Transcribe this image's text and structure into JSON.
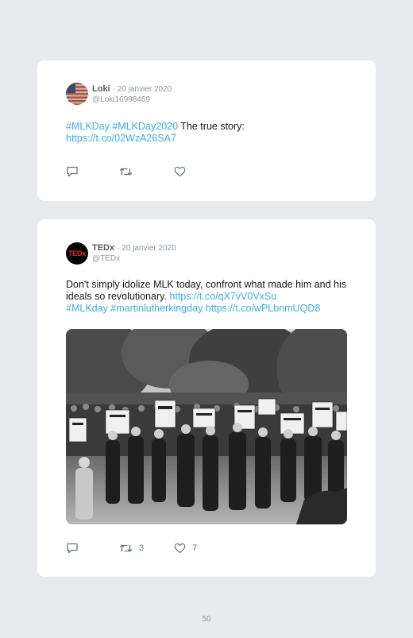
{
  "tweets": [
    {
      "name": "Loki",
      "date": "· 20 janvier 2020",
      "handle": "@Loki16998469",
      "text_parts": [
        {
          "t": "#MLKDay #MLKDay2020",
          "link": true
        },
        {
          "t": " The true story:",
          "link": false
        },
        {
          "t": "https://t.co/02WzA26SA7",
          "link": true
        }
      ],
      "retweets": "",
      "likes": ""
    },
    {
      "name": "TEDx",
      "date": "· 20 janvier 2020",
      "handle": "@TEDx",
      "avatar_text": "TEDx",
      "text_parts": [
        {
          "t": "Don't simply idolize MLK today, confront what made him and his ideals so revolutionary.",
          "link": false
        },
        {
          "t": "https://t.co/qX7vV0VxSu",
          "link": true
        },
        {
          "t": "#MLKday #martinlutherkingday https://t.co/wPLbnmUQD8",
          "link": true
        }
      ],
      "retweets": "3",
      "likes": "7"
    }
  ],
  "page_number": "50",
  "colors": {
    "background": "#e8eaed",
    "card": "#ffffff",
    "link": "#3aaee6",
    "muted": "#8e96a0",
    "ted_red": "#e62b1e"
  },
  "icons": [
    "reply-icon",
    "retweet-icon",
    "like-icon"
  ]
}
